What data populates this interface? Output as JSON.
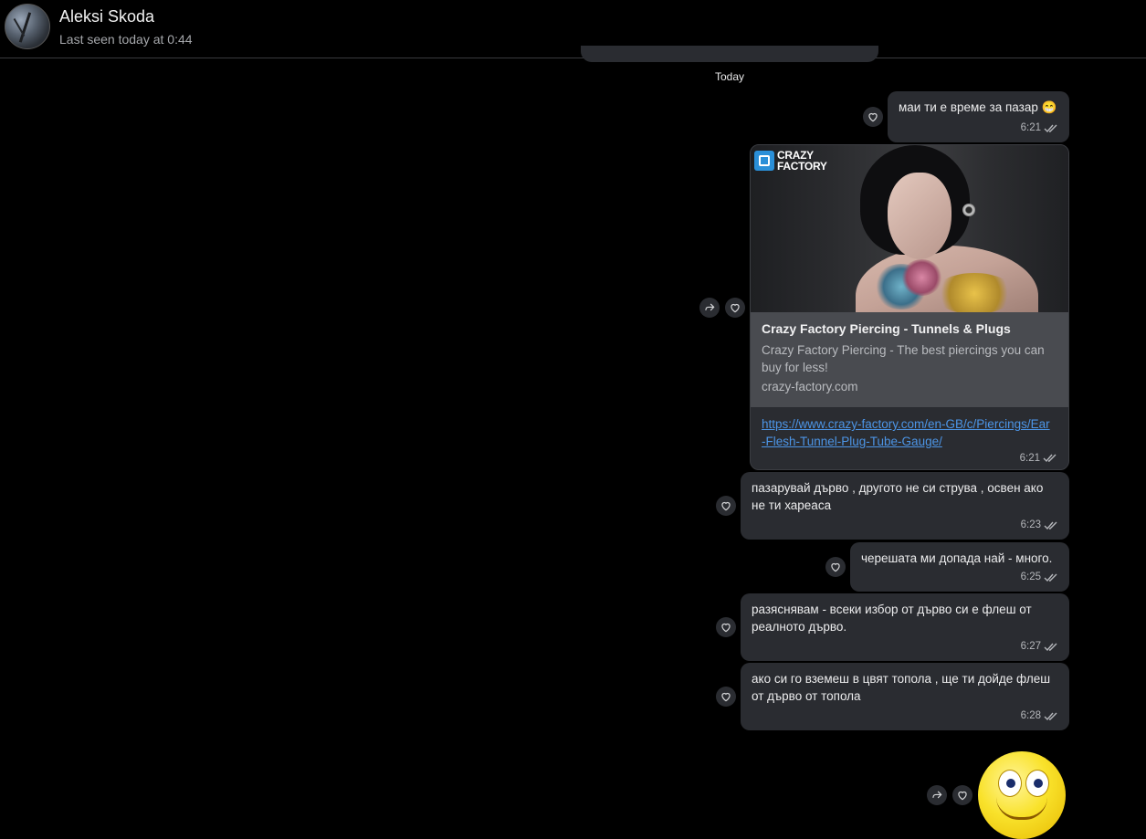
{
  "header": {
    "contact_name": "Aleksi Skoda",
    "last_seen": "Last seen today at 0:44"
  },
  "day_separator": "Today",
  "messages": [
    {
      "text": "маи ти е време за пазар",
      "emoji": "😁",
      "time": "6:21"
    },
    {
      "link_preview": {
        "brand_logo": "CRAZY FACTORY",
        "title": "Crazy Factory Piercing - Tunnels & Plugs",
        "description": "Crazy Factory Piercing - The best piercings you can buy for less!",
        "domain": "crazy-factory.com",
        "url": "https://www.crazy-factory.com/en-GB/c/Piercings/Ear-Flesh-Tunnel-Plug-Tube-Gauge/"
      },
      "time": "6:21"
    },
    {
      "text": "пазарувай дърво , другото не си струва , освен ако не ти хареаса",
      "time": "6:23"
    },
    {
      "text": "черешата ми допада най - много.",
      "time": "6:25"
    },
    {
      "text": "разяснявам - всеки избор от дърво си е флеш от реалното дърво.",
      "time": "6:27"
    },
    {
      "text": "ако си го вземеш в цвят топола , ще ти дойде флеш от дърво от топола",
      "time": "6:28"
    }
  ],
  "icons": {
    "react": "heart-icon",
    "forward": "forward-icon",
    "status": "double-check-icon"
  },
  "colors": {
    "background": "#000000",
    "bubble": "#2a2c31",
    "link": "#4c95e6"
  }
}
